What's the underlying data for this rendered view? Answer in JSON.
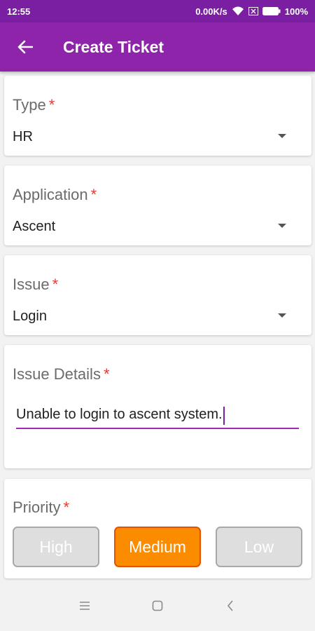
{
  "status_bar": {
    "time": "12:55",
    "speed": "0.00K/s",
    "battery": "100%",
    "icons": [
      "wifi-icon",
      "sim-off-icon",
      "battery-icon"
    ]
  },
  "app_bar": {
    "title": "Create Ticket",
    "back_icon": "arrow-left-icon",
    "color": "#8e24aa"
  },
  "form": {
    "type": {
      "label": "Type",
      "required": "*",
      "value": "HR"
    },
    "application": {
      "label": "Application",
      "required": "*",
      "value": "Ascent"
    },
    "issue": {
      "label": "Issue",
      "required": "*",
      "value": "Login"
    },
    "issue_details": {
      "label": "Issue Details",
      "required": "*",
      "value": "Unable to login to ascent system."
    },
    "priority": {
      "label": "Priority",
      "required": "*",
      "options": [
        "High",
        "Medium",
        "Low"
      ],
      "selected": "Medium"
    }
  },
  "nav_bar": {
    "icons": [
      "menu-icon",
      "home-square-icon",
      "back-chevron-icon"
    ]
  },
  "colors": {
    "accent": "#8e24aa",
    "required": "#e53935",
    "selected": "#fb8c00"
  }
}
